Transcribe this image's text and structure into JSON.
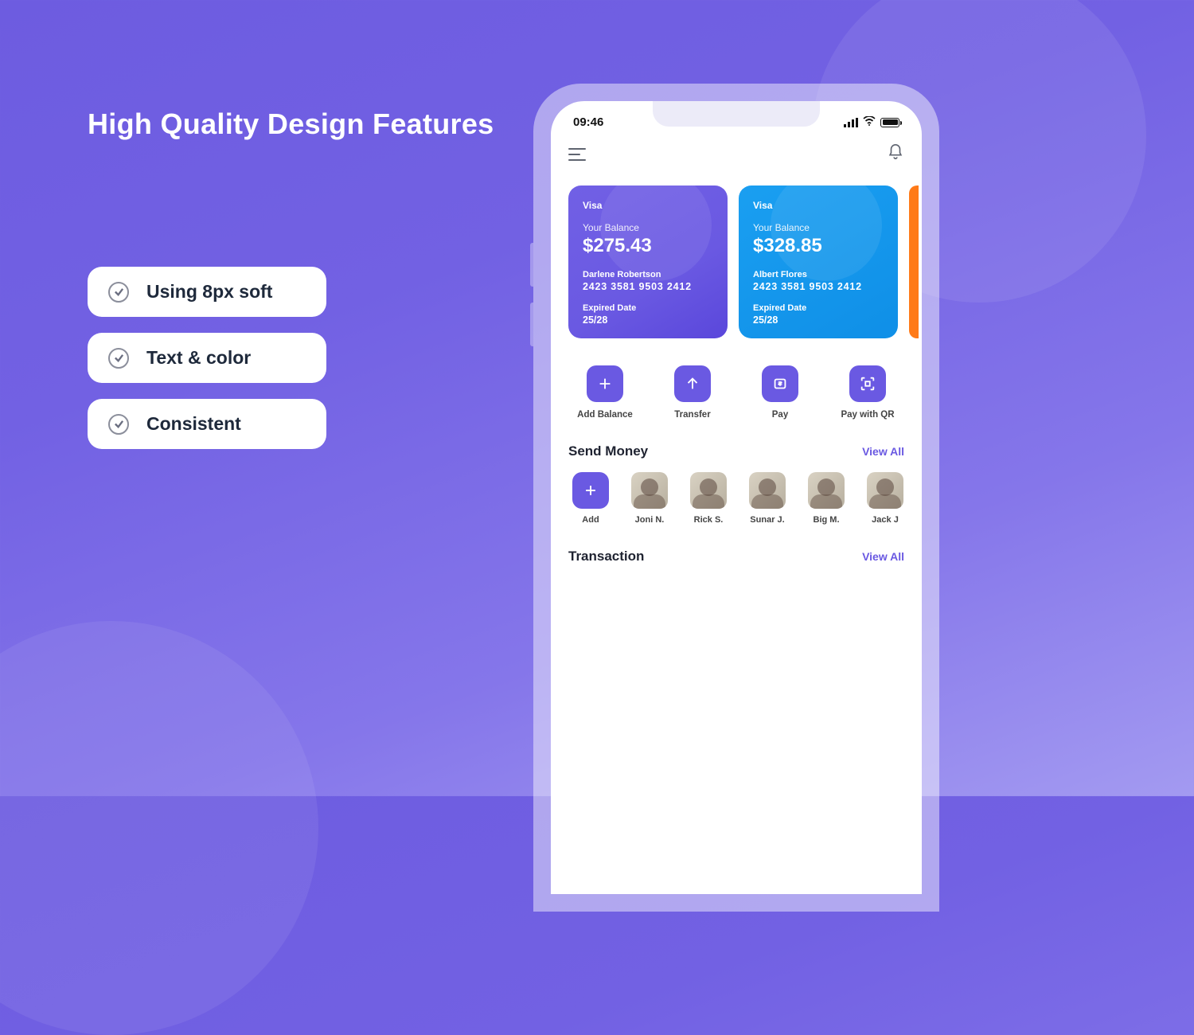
{
  "hero_title": "High Quality Design Features",
  "features": [
    {
      "label": "Using 8px soft"
    },
    {
      "label": "Text & color"
    },
    {
      "label": "Consistent"
    }
  ],
  "status_bar": {
    "time": "09:46"
  },
  "cards": [
    {
      "brand": "Visa",
      "balance_label": "Your Balance",
      "balance": "$275.43",
      "holder": "Darlene Robertson",
      "number": "2423 3581 9503 2412",
      "expired_label": "Expired Date",
      "expired": "25/28"
    },
    {
      "brand": "Visa",
      "balance_label": "Your Balance",
      "balance": "$328.85",
      "holder": "Albert Flores",
      "number": "2423 3581 9503 2412",
      "expired_label": "Expired Date",
      "expired": "25/28"
    }
  ],
  "actions": {
    "add_balance": "Add Balance",
    "transfer": "Transfer",
    "pay": "Pay",
    "pay_qr": "Pay with QR"
  },
  "send_money": {
    "title": "Send Money",
    "view_all": "View All",
    "add_label": "Add",
    "contacts": [
      {
        "name": "Joni N."
      },
      {
        "name": "Rick S."
      },
      {
        "name": "Sunar J."
      },
      {
        "name": "Big M."
      },
      {
        "name": "Jack J"
      }
    ]
  },
  "transaction": {
    "title": "Transaction",
    "view_all": "View All"
  }
}
